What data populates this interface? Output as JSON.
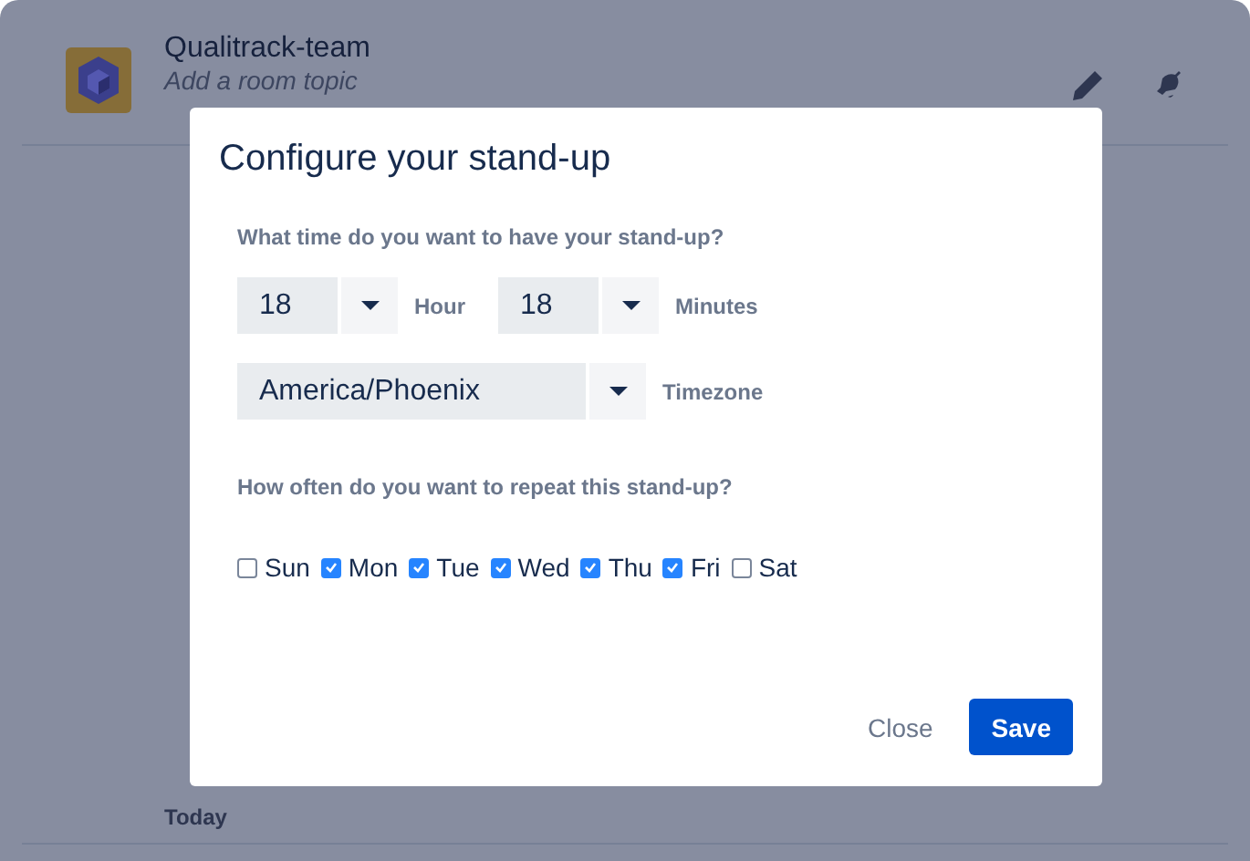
{
  "room": {
    "name": "Qualitrack-team",
    "topic_placeholder": "Add a room topic"
  },
  "timeline": {
    "day_label": "Today"
  },
  "dialog": {
    "title": "Configure your stand-up",
    "time_question": "What time do you want to have your stand-up?",
    "hour": {
      "value": "18",
      "label": "Hour"
    },
    "minutes": {
      "value": "18",
      "label": "Minutes"
    },
    "timezone": {
      "value": "America/Phoenix",
      "label": "Timezone"
    },
    "repeat_question": "How often do you want to repeat this stand-up?",
    "days": [
      {
        "label": "Sun",
        "checked": false
      },
      {
        "label": "Mon",
        "checked": true
      },
      {
        "label": "Tue",
        "checked": true
      },
      {
        "label": "Wed",
        "checked": true
      },
      {
        "label": "Thu",
        "checked": true
      },
      {
        "label": "Fri",
        "checked": true
      },
      {
        "label": "Sat",
        "checked": false
      }
    ],
    "buttons": [
      {
        "label": "Close",
        "kind": "secondary"
      },
      {
        "label": "Save",
        "kind": "primary"
      }
    ]
  }
}
